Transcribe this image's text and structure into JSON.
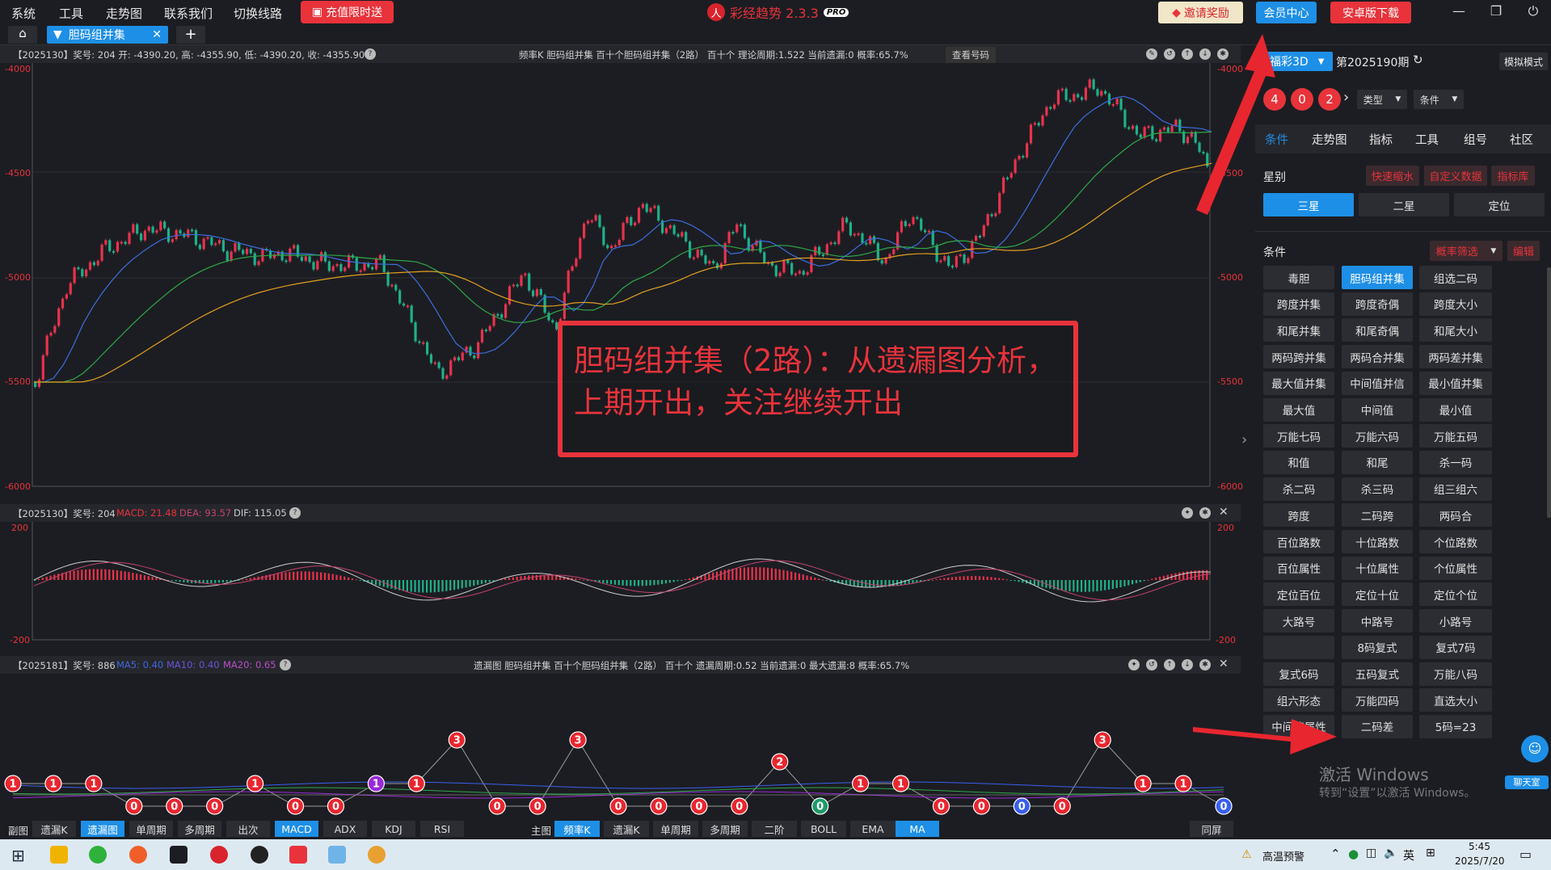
{
  "menu": {
    "items": [
      "系统",
      "工具",
      "走势图",
      "联系我们",
      "切换线路"
    ],
    "recharge": "充值限时送",
    "brand": "彩经趋势 2.3.3",
    "brand_badge": "PRO",
    "invite": "邀请奖励",
    "vip": "会员中心",
    "android": "安卓版下载"
  },
  "tabs": {
    "home": "⌂",
    "active": "胆码组并集",
    "add": "+"
  },
  "kpanel": {
    "info": "【2025130】奖号: 204  开: -4390.20, 高: -4355.90, 低: -4390.20, 收: -4355.90",
    "center": "频率K   胆码组并集   百十个胆码组并集（2路）   百十个   理论周期:1.522   当前遗漏:0   概率:65.7%",
    "view_btn": "查看号码",
    "y_labels": [
      "-4000",
      "-4500",
      "-5000",
      "-5500",
      "-6000"
    ]
  },
  "macdpanel": {
    "info": "【2025130】奖号: 204 ",
    "macd": "MACD: 21.48",
    "dea": "DEA: 93.57",
    "dif": "DIF: 115.05",
    "y_labels": [
      "200",
      "-200"
    ]
  },
  "misspanel": {
    "info": "【2025181】奖号: 886 ",
    "ma5": "MA5: 0.40",
    "ma10": "MA10: 0.40",
    "ma20": "MA20: 0.65",
    "center": "遗漏图   胆码组并集   百十个胆码组并集（2路）   百十个   遗漏周期:0.52   当前遗漏:0   最大遗漏:8   概率:65.7%",
    "nodes": [
      1,
      1,
      1,
      0,
      0,
      0,
      1,
      0,
      0,
      1,
      1,
      3,
      0,
      0,
      3,
      0,
      0,
      0,
      0,
      2,
      0,
      1,
      1,
      0,
      0,
      0,
      0,
      3,
      1,
      1,
      0
    ],
    "node_colors": {
      "0": "#e8262f",
      "1": "#e8262f",
      "2": "#e8262f",
      "3": "#e8262f",
      "purple": "#9a28d6",
      "green": "#1f9a6a",
      "blue": "#3a5ff0"
    }
  },
  "callout": {
    "line1": "胆码组并集（2路）：从遗漏图分析，",
    "line2": "上期开出，关注继续开出"
  },
  "bottom": {
    "sub_label": "副图",
    "sub_btns": [
      "遗漏K",
      "遗漏图",
      "单周期",
      "多周期",
      "出次",
      "MACD",
      "ADX",
      "KDJ",
      "RSI"
    ],
    "main_label": "主图",
    "main_btns": [
      "频率K",
      "遗漏K",
      "单周期",
      "多周期",
      "二阶",
      "BOLL",
      "EMA",
      "MA"
    ],
    "right_btn": "同屏"
  },
  "right": {
    "lottery": "福彩3D",
    "issue": "第2025190期",
    "sim": "模拟模式",
    "balls": [
      "4",
      "0",
      "2"
    ],
    "type_sel": "类型",
    "cond_sel": "条件",
    "tabs": [
      "条件",
      "走势图",
      "指标",
      "工具",
      "组号",
      "社区"
    ],
    "star_label": "星别",
    "links": [
      "快速缩水",
      "自定义数据",
      "指标库"
    ],
    "stars": [
      "三星",
      "二星",
      "定位"
    ],
    "cond_label": "条件",
    "prob_filter": "概率筛选",
    "edit": "编辑",
    "grid": [
      [
        "毒胆",
        "胆码组并集",
        "组选二码"
      ],
      [
        "跨度并集",
        "跨度奇偶",
        "跨度大小"
      ],
      [
        "和尾并集",
        "和尾奇偶",
        "和尾大小"
      ],
      [
        "两码跨并集",
        "两码合并集",
        "两码差并集"
      ],
      [
        "最大值并集",
        "中间值并信",
        "最小值并集"
      ],
      [
        "最大值",
        "中间值",
        "最小值"
      ],
      [
        "万能七码",
        "万能六码",
        "万能五码"
      ],
      [
        "和值",
        "和尾",
        "杀一码"
      ],
      [
        "杀二码",
        "杀三码",
        "组三组六"
      ],
      [
        "跨度",
        "二码跨",
        "两码合"
      ],
      [
        "百位路数",
        "十位路数",
        "个位路数"
      ],
      [
        "百位属性",
        "十位属性",
        "个位属性"
      ],
      [
        "定位百位",
        "定位十位",
        "定位个位"
      ],
      [
        "大路号",
        "中路号",
        "小路号"
      ],
      [
        "",
        "8码复式",
        "复式7码"
      ],
      [
        "复式6码",
        "五码复式",
        "万能八码"
      ],
      [
        "组六形态",
        "万能四码",
        "直选大小"
      ],
      [
        "中间值属性",
        "二码差",
        "5码=23"
      ]
    ],
    "chat": "聊天室"
  },
  "watermark": {
    "line1": "激活 Windows",
    "line2": "转到“设置”以激活 Windows。"
  },
  "taskbar": {
    "weather": "高温预警",
    "ime": "英",
    "time": "5:45",
    "date": "2025/7/20"
  }
}
